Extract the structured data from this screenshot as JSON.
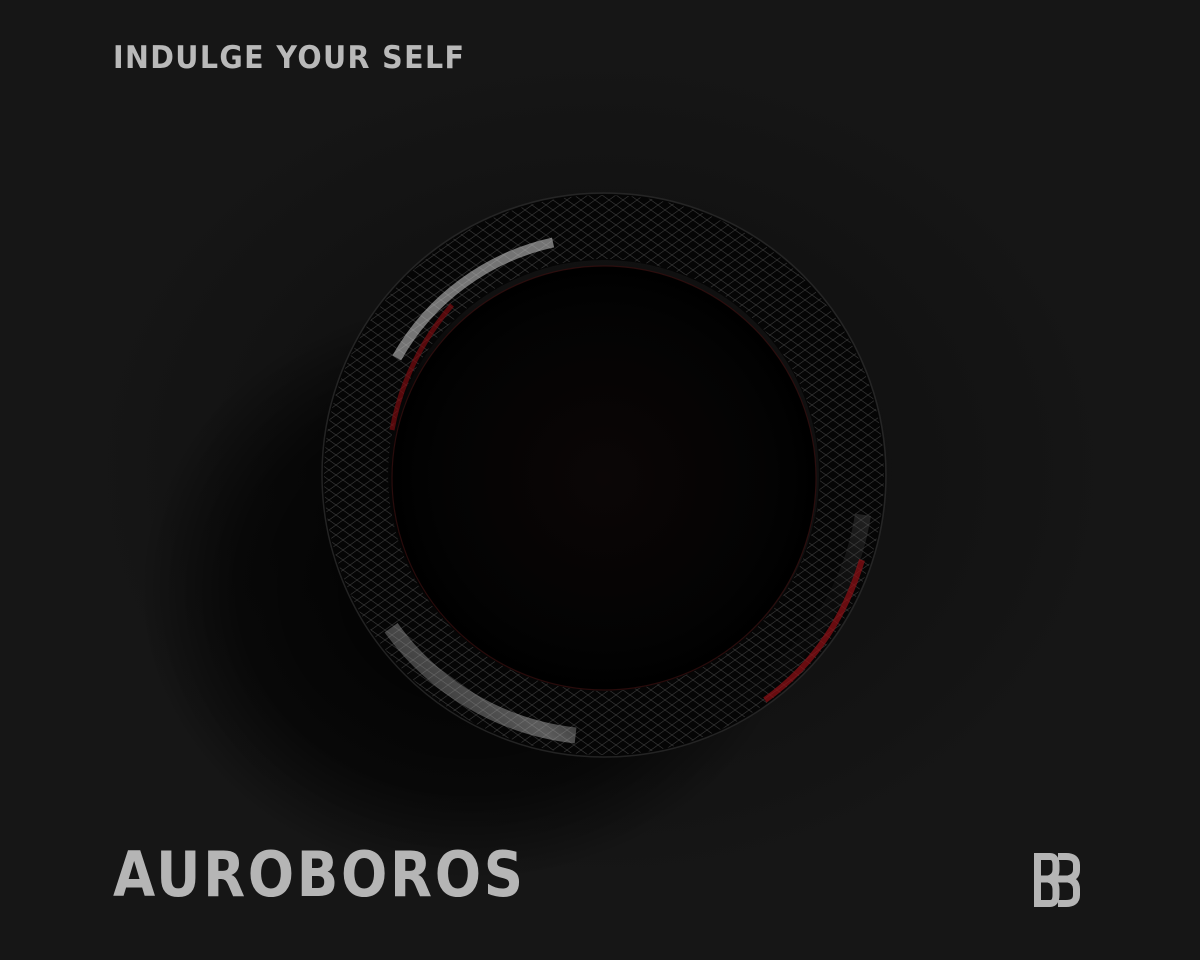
{
  "tagline": "INDULGE YOUR SELF",
  "title": "AUROBOROS",
  "logo": "double-b-logo",
  "artwork": {
    "subject": "ouroboros-ring-icon",
    "colors": {
      "background": "#121212",
      "ring": "#050505",
      "highlight": "#d8d8d8",
      "accent": "#8a0f14",
      "text": "#b5b5b5"
    }
  }
}
